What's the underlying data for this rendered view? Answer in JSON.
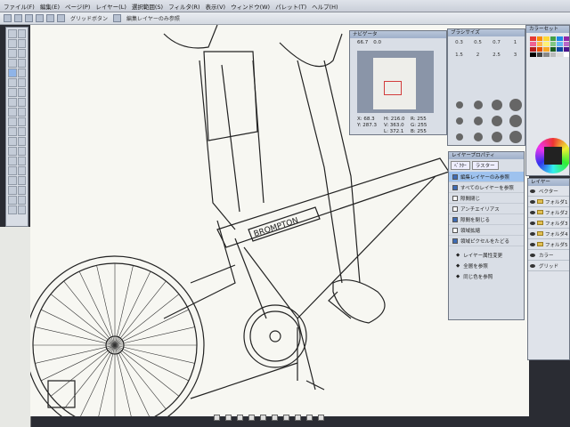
{
  "menu": [
    "ファイル(F)",
    "編集(E)",
    "ページ(P)",
    "レイヤー(L)",
    "選択範囲(S)",
    "フィルタ(R)",
    "表示(V)",
    "ウィンドウ(W)",
    "パレット(T)",
    "ヘルプ(H)"
  ],
  "toolbar": {
    "label1": "グリッドボタン",
    "label2": "編集レイヤーのみ参照"
  },
  "navigator": {
    "title": "ナビゲータ",
    "zoom": "66.7",
    "rotate": "0.0",
    "readout": [
      "X: 68.3",
      "H: 216.0",
      "R: 255",
      "Y: 287.3",
      "V: 363.0",
      "G: 255",
      "",
      "L: 372.1",
      "B: 255"
    ]
  },
  "brushes": {
    "title": "ブラシサイズ",
    "sizes": [
      "0.3",
      "0.5",
      "0.7",
      "1",
      "1.5",
      "2",
      "2.5",
      "3"
    ]
  },
  "color_panel": {
    "title": "カラーセット"
  },
  "layer_settings": {
    "title": "レイヤープロパティ",
    "tabs": [
      "ﾍﾞｸﾀｰ",
      "ラスター"
    ],
    "rows": [
      {
        "label": "編集レイヤーのみ参照",
        "checked": true,
        "highlight": true
      },
      {
        "label": "すべてのレイヤーを参照",
        "checked": true,
        "highlight": false
      },
      {
        "label": "隙間閉じ",
        "checked": false,
        "highlight": false
      },
      {
        "label": "アンチエイリアス",
        "checked": false,
        "highlight": false
      },
      {
        "label": "隙間を閉じる",
        "checked": true,
        "highlight": false
      },
      {
        "label": "領域拡縮",
        "checked": false,
        "highlight": false
      },
      {
        "label": "領域ピクセルをたどる",
        "checked": true,
        "highlight": false
      }
    ],
    "actions": [
      "レイヤー属性変更",
      "全層を参照",
      "同じ色を参照"
    ]
  },
  "layers": {
    "title": "レイヤー",
    "items": [
      "ベクター",
      "フォルダ1",
      "フォルダ2",
      "フォルダ3",
      "フォルダ4",
      "フォルダ5",
      "カラー",
      "グリッド"
    ]
  },
  "canvas_text": {
    "brand": "BROMPTON"
  }
}
